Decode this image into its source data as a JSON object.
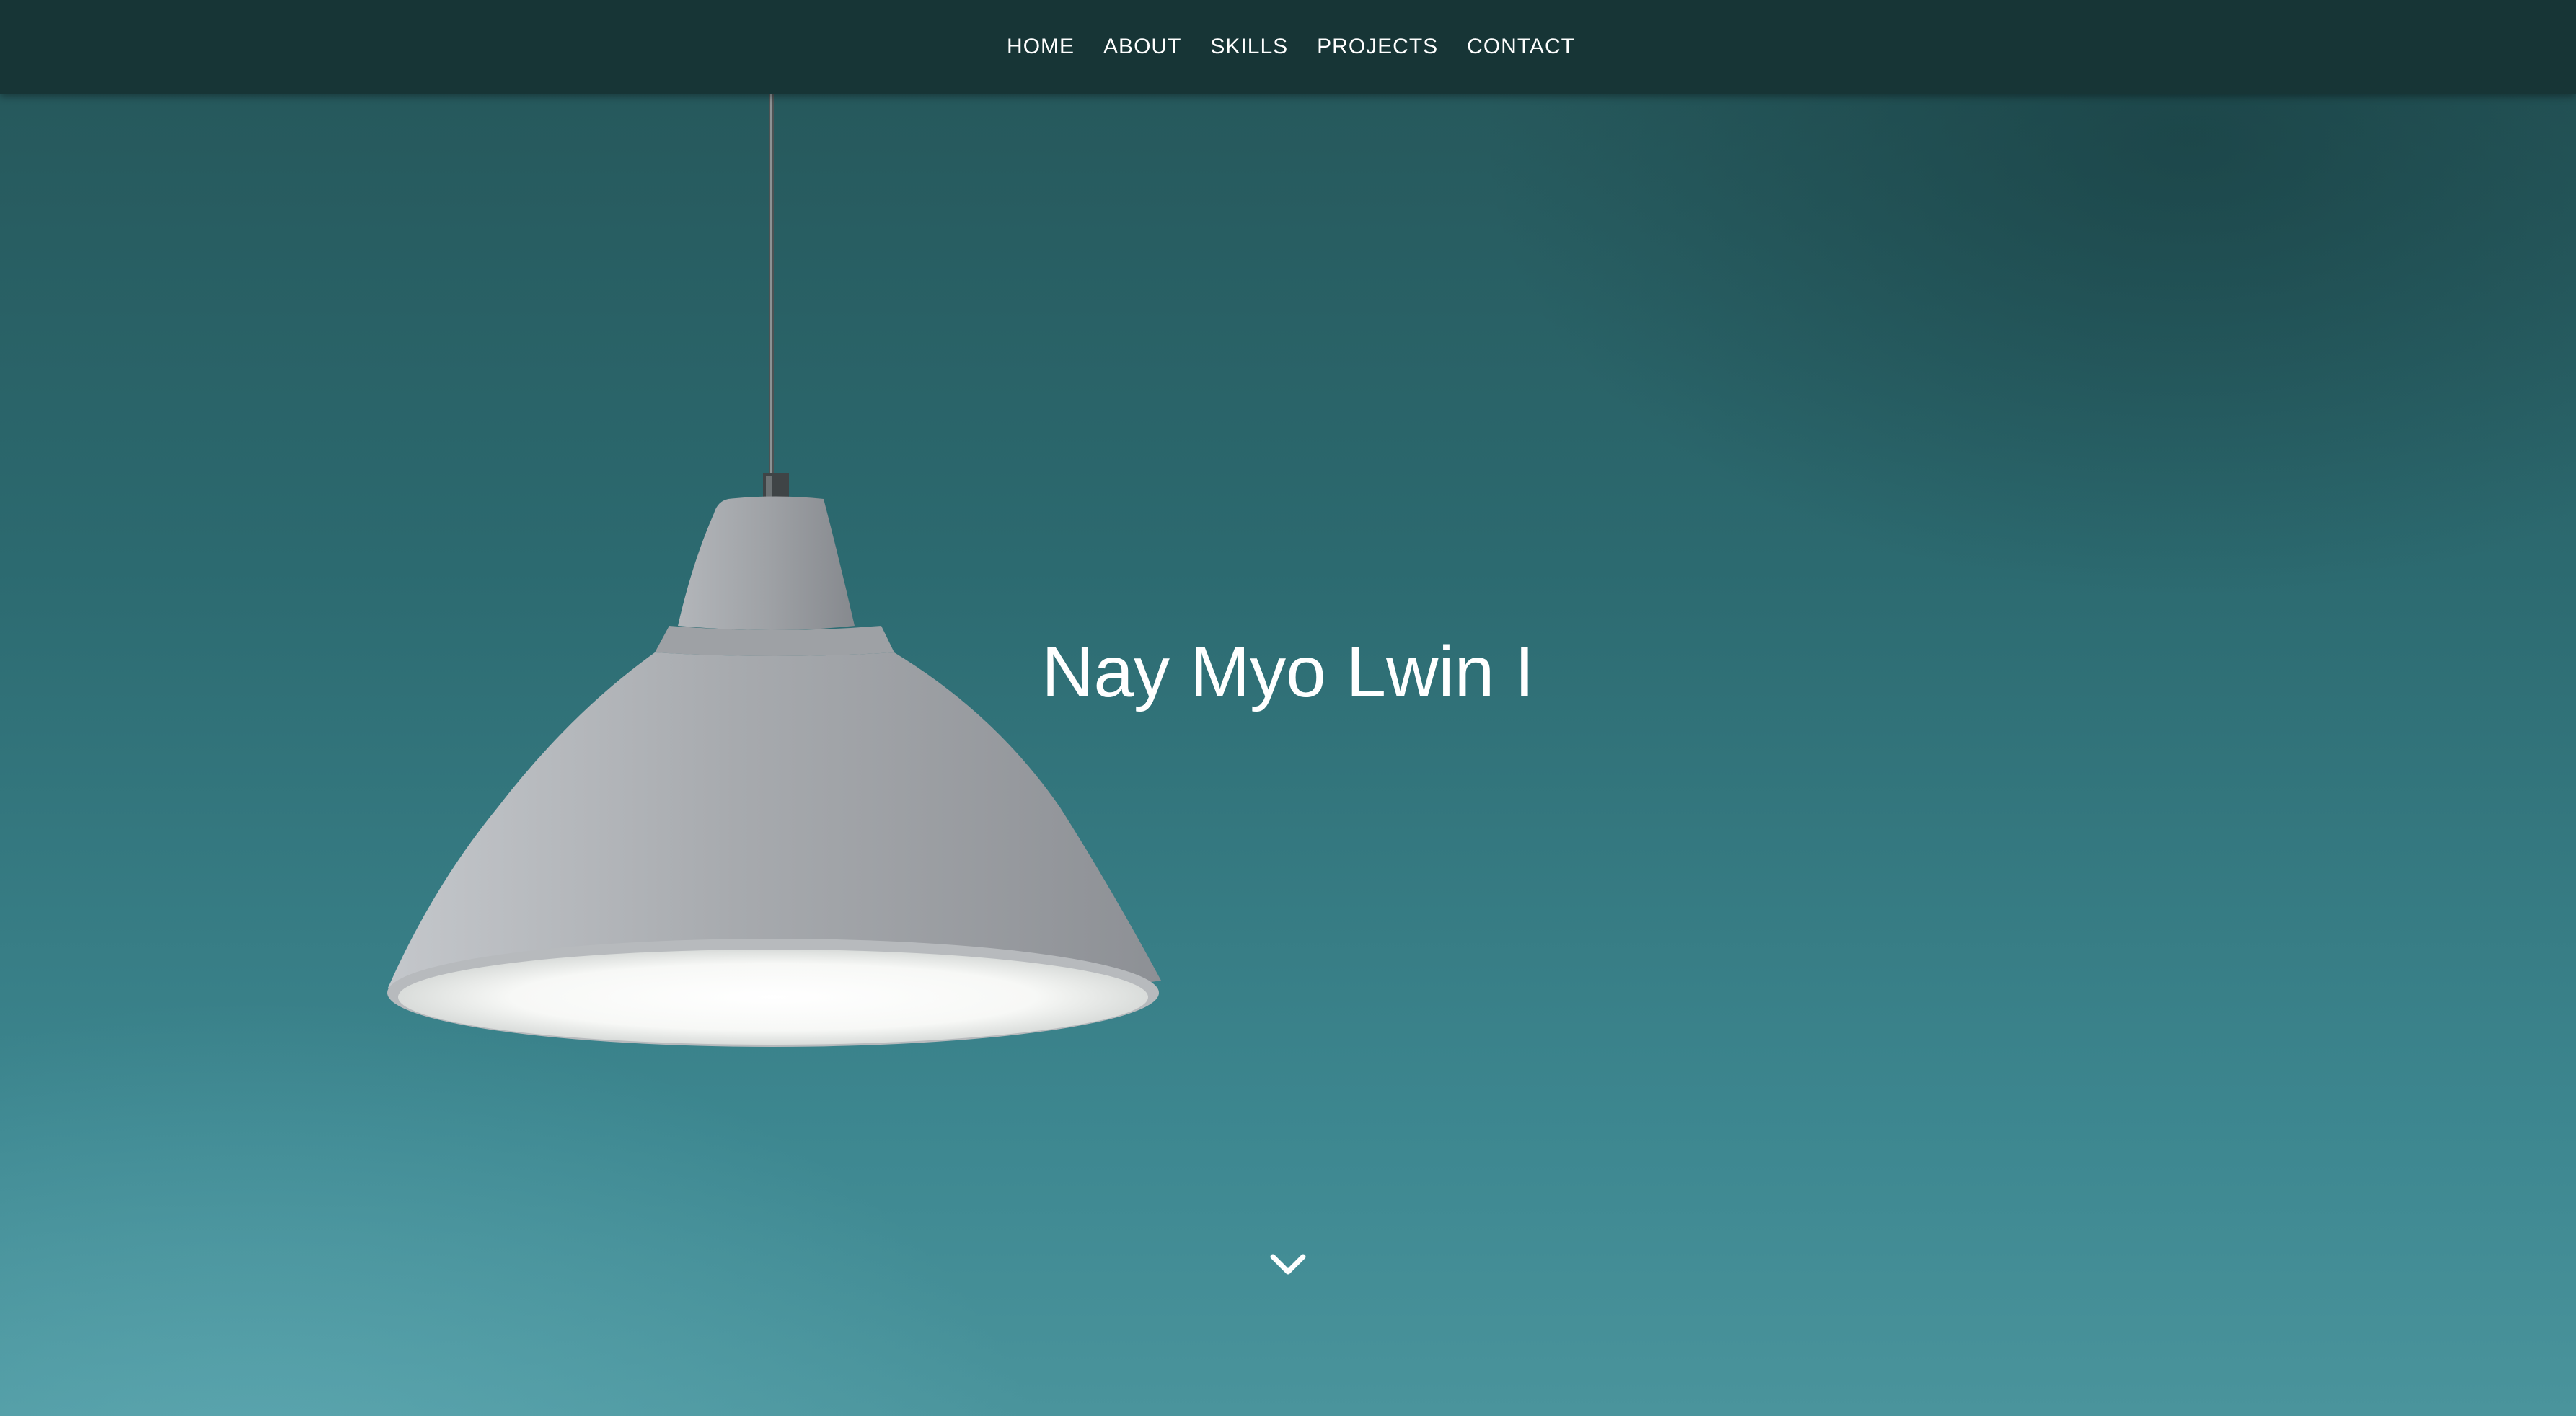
{
  "nav": {
    "items": [
      {
        "label": "HOME"
      },
      {
        "label": "ABOUT"
      },
      {
        "label": "SKILLS"
      },
      {
        "label": "PROJECTS"
      },
      {
        "label": "CONTACT"
      }
    ]
  },
  "hero": {
    "title": "Nay Myo Lwin I",
    "background_image": "pendant-lamp-on-teal-wall",
    "scroll_icon": "chevron-down-icon"
  },
  "colors": {
    "navbar": "#173536",
    "wall": "#2c6a70",
    "text": "#ffffff",
    "lamp": "#a9acb0"
  }
}
